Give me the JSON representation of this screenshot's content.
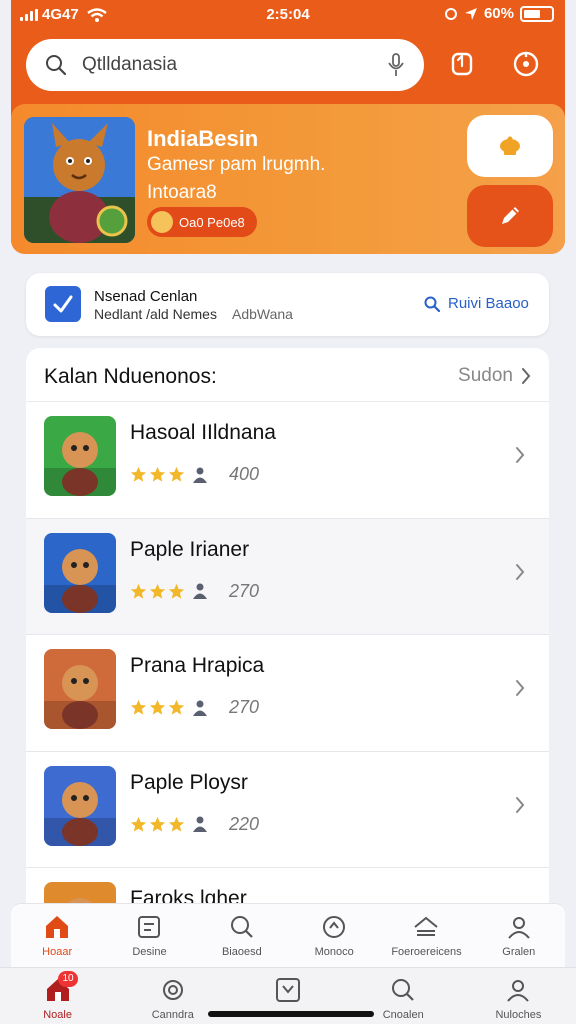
{
  "status_bar": {
    "carrier": "4G47",
    "time": "2:5:04",
    "battery": "60%"
  },
  "search": {
    "value": "Qtlldanasia"
  },
  "promo": {
    "title": "IndiaBesin",
    "subtitle_1": "Gamesr pam lrugmh.",
    "subtitle_2": "Intoara8",
    "pill": "Oa0 Pe0e8"
  },
  "info": {
    "title": "Nsenad Cenlan",
    "subtitle": "Nedlant /ald Nemes",
    "middle": "AdbWana",
    "link": "Ruivi Baaoo"
  },
  "list": {
    "title": "Kalan Nduenonos:",
    "see_all": "Sudon",
    "items": [
      {
        "name": "Hasoal IIldnana",
        "count": "400",
        "rating": 3.5,
        "color": "#3aa845"
      },
      {
        "name": "Paple Irianer",
        "count": "270",
        "rating": 3.5,
        "color": "#2b66c8"
      },
      {
        "name": "Prana Hrapica",
        "count": "270",
        "rating": 3.5,
        "color": "#cf6a3a"
      },
      {
        "name": "Paple Ploysr",
        "count": "220",
        "rating": 3.5,
        "color": "#3e6bd0"
      },
      {
        "name": "Faroks lqher",
        "count": "",
        "rating": 0,
        "color": "#e08a2e"
      }
    ]
  },
  "nav": {
    "items": [
      "Hoaar",
      "Desine",
      "Biaoesd",
      "Monoco",
      "Foeroereicens",
      "Gralen"
    ]
  },
  "tabbar": {
    "items": [
      "Noale",
      "Canndra",
      "Cnoalen",
      "Nuloches"
    ],
    "badge": "10"
  },
  "colors": {
    "accent": "#ea5c1a",
    "promo": "#f39a3a",
    "star": "#f3b82a",
    "link": "#2760c9"
  }
}
